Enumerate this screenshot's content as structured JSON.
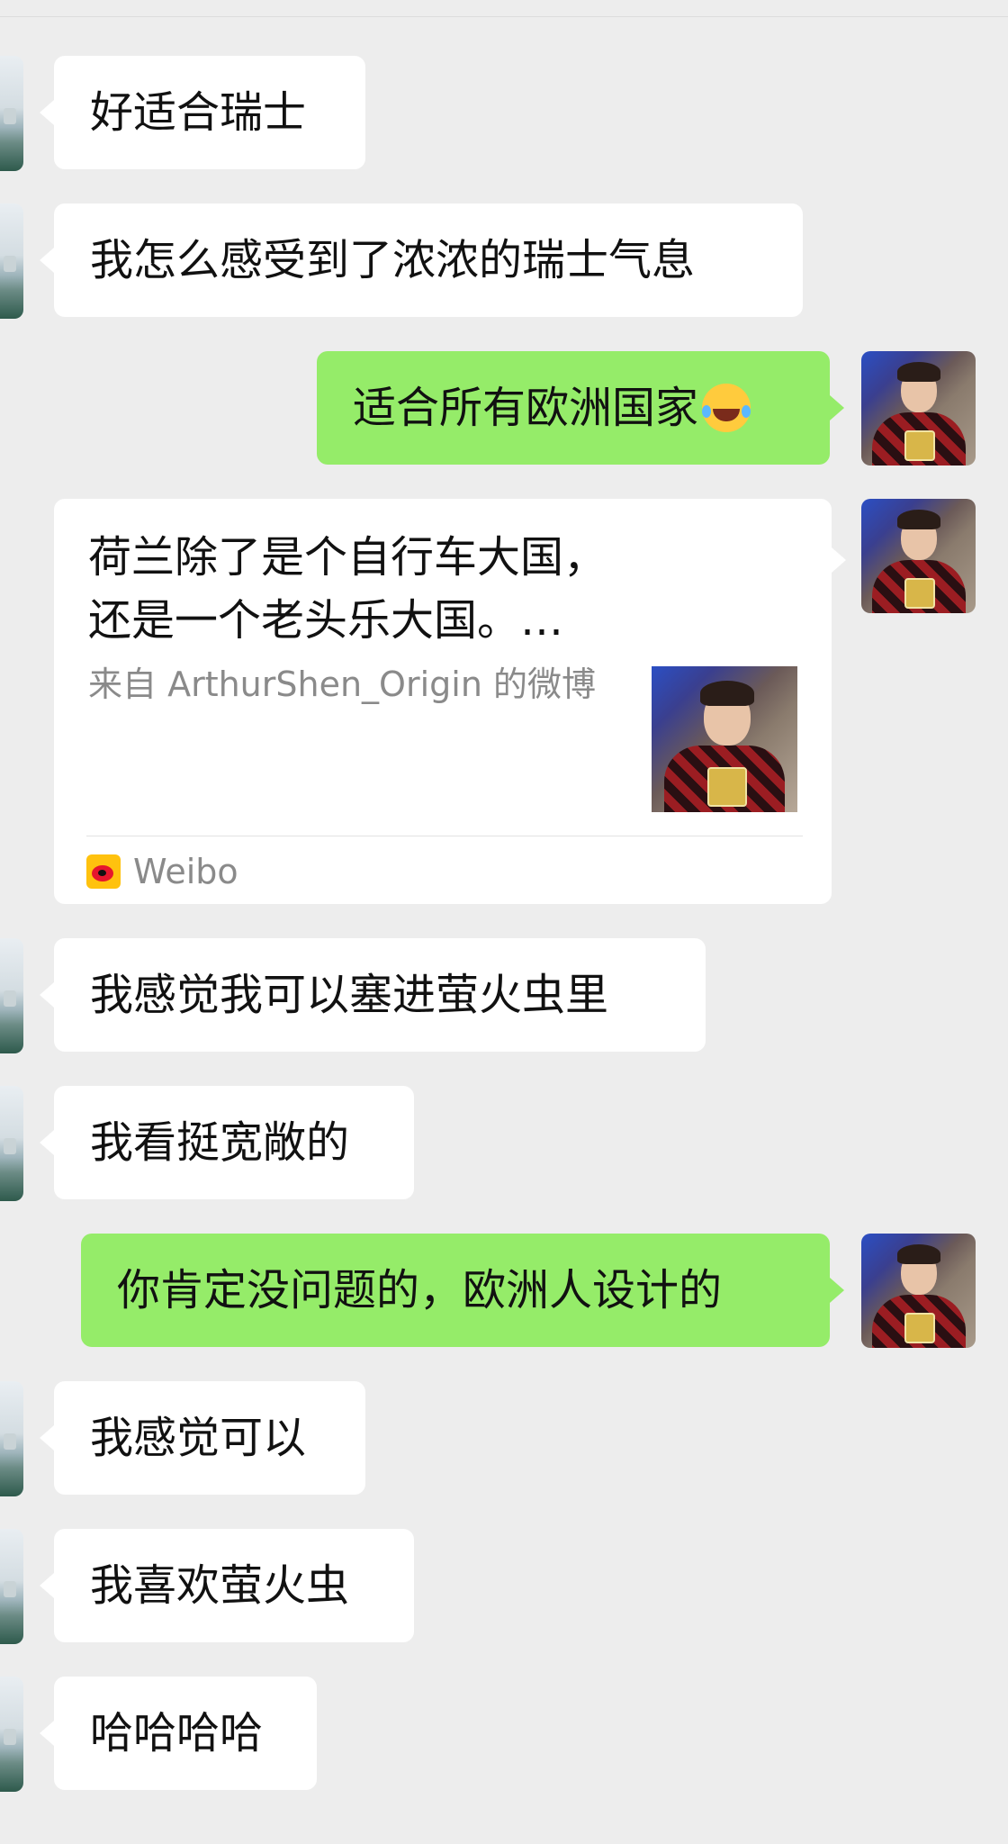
{
  "messages": [
    {
      "text": "好适合瑞士"
    },
    {
      "text": "我怎么感受到了浓浓的瑞士气息"
    },
    {
      "text": "适合所有欧洲国家"
    },
    {
      "text": "我感觉我可以塞进萤火虫里"
    },
    {
      "text": "我看挺宽敞的"
    },
    {
      "text": "你肯定没问题的，欧洲人设计的"
    },
    {
      "text": "我感觉可以"
    },
    {
      "text": "我喜欢萤火虫"
    },
    {
      "text": "哈哈哈哈"
    }
  ],
  "link_card": {
    "title": "荷兰除了是个自行车大国，还是一个老头乐大国。…",
    "source": "来自 ArthurShen_Origin 的微博",
    "footer_label": "Weibo",
    "footer_icon": "weibo-icon"
  },
  "colors": {
    "background": "#ededed",
    "incoming_bubble": "#ffffff",
    "outgoing_bubble": "#95ec69"
  }
}
